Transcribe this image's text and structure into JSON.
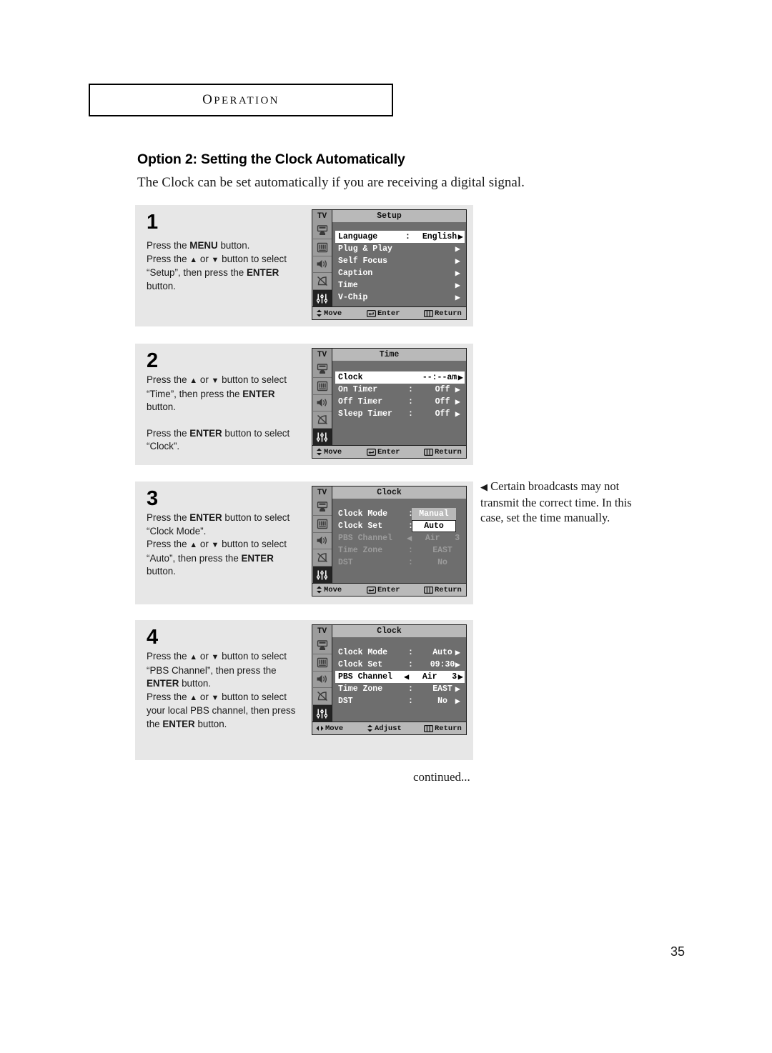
{
  "page": {
    "chapter": "Operation",
    "chapter_first_letter": "O",
    "chapter_rest": "PERATION",
    "section_title": "Option 2: Setting the Clock Automatically",
    "section_intro": "The Clock can be set automatically if you are receiving a digital signal.",
    "continued_label": "continued...",
    "page_number": "35"
  },
  "side_note": {
    "arrow": "◀",
    "text": "Certain broadcasts may not transmit the correct time. In this case, set the time manually."
  },
  "glyphs": {
    "up_arrow": "▲",
    "down_arrow": "▼",
    "right_arrow": "▶",
    "left_arrow": "◀"
  },
  "colors": {
    "panel_bg": "#e7e7e7",
    "osd_body": "#6e6e6e",
    "osd_bar": "#b9b9b9",
    "osd_side": "#9c9c9c",
    "osd_active_icon": "#232323",
    "highlight_bg": "#ffffff",
    "dim_text": "#9b9b9b"
  },
  "steps": [
    {
      "number": "1",
      "lines": [
        {
          "parts": [
            {
              "t": "Press the ",
              "b": false
            },
            {
              "t": "MENU",
              "b": true
            },
            {
              "t": " button.",
              "b": false
            }
          ]
        },
        {
          "parts": [
            {
              "t": "Press the ",
              "b": false
            },
            {
              "t": "▲",
              "b": false
            },
            {
              "t": " or ",
              "b": false
            },
            {
              "t": "▼",
              "b": false
            },
            {
              "t": " button to select",
              "b": false
            }
          ]
        },
        {
          "parts": [
            {
              "t": "“Setup”, then press the ",
              "b": false
            },
            {
              "t": "ENTER",
              "b": true
            }
          ]
        },
        {
          "parts": [
            {
              "t": "button.",
              "b": false
            }
          ]
        }
      ],
      "osd": {
        "tv_label": "TV",
        "title": "Setup",
        "active_icon_index": 4,
        "rows": [
          {
            "label": "Language",
            "colon": ":",
            "value": "English",
            "arrow": "right",
            "state": "highlight"
          },
          {
            "label": "Plug & Play",
            "colon": "",
            "value": "",
            "arrow": "right",
            "state": "normal"
          },
          {
            "label": "Self Focus",
            "colon": "",
            "value": "",
            "arrow": "right",
            "state": "normal"
          },
          {
            "label": "Caption",
            "colon": "",
            "value": "",
            "arrow": "right",
            "state": "normal"
          },
          {
            "label": "Time",
            "colon": "",
            "value": "",
            "arrow": "right",
            "state": "normal"
          },
          {
            "label": "V-Chip",
            "colon": "",
            "value": "",
            "arrow": "right",
            "state": "normal"
          }
        ],
        "footer": {
          "move": "Move",
          "move_glyph": "updown",
          "mid": "Enter",
          "mid_glyph": "enter",
          "return": "Return",
          "return_glyph": "menu"
        }
      }
    },
    {
      "number": "2",
      "lines": [
        {
          "parts": [
            {
              "t": "Press the ",
              "b": false
            },
            {
              "t": "▲",
              "b": false
            },
            {
              "t": " or ",
              "b": false
            },
            {
              "t": "▼",
              "b": false
            },
            {
              "t": " button to select",
              "b": false
            }
          ]
        },
        {
          "parts": [
            {
              "t": "“Time”, then press the ",
              "b": false
            },
            {
              "t": "ENTER",
              "b": true
            }
          ]
        },
        {
          "parts": [
            {
              "t": "button.",
              "b": false
            }
          ]
        },
        {
          "gap": true
        },
        {
          "parts": [
            {
              "t": "Press the ",
              "b": false
            },
            {
              "t": "ENTER",
              "b": true
            },
            {
              "t": " button to select",
              "b": false
            }
          ]
        },
        {
          "parts": [
            {
              "t": "“Clock”.",
              "b": false
            }
          ]
        }
      ],
      "osd": {
        "tv_label": "TV",
        "title": "Time",
        "active_icon_index": 4,
        "rows": [
          {
            "label": "Clock",
            "colon": "",
            "value": "--:--am",
            "arrow": "right",
            "state": "highlight"
          },
          {
            "label": "On Timer",
            "colon": ":",
            "value": "Off",
            "arrow": "right",
            "state": "normal"
          },
          {
            "label": "Off Timer",
            "colon": ":",
            "value": "Off",
            "arrow": "right",
            "state": "normal"
          },
          {
            "label": "Sleep Timer",
            "colon": ":",
            "value": "Off",
            "arrow": "right",
            "state": "normal"
          }
        ],
        "footer": {
          "move": "Move",
          "move_glyph": "updown",
          "mid": "Enter",
          "mid_glyph": "enter",
          "return": "Return",
          "return_glyph": "menu"
        }
      }
    },
    {
      "number": "3",
      "lines": [
        {
          "parts": [
            {
              "t": "Press the ",
              "b": false
            },
            {
              "t": "ENTER",
              "b": true
            },
            {
              "t": " button to select",
              "b": false
            }
          ]
        },
        {
          "parts": [
            {
              "t": "“Clock Mode”.",
              "b": false
            }
          ]
        },
        {
          "parts": [
            {
              "t": "Press the ",
              "b": false
            },
            {
              "t": "▲",
              "b": false
            },
            {
              "t": " or ",
              "b": false
            },
            {
              "t": "▼",
              "b": false
            },
            {
              "t": " button to select",
              "b": false
            }
          ]
        },
        {
          "parts": [
            {
              "t": "“Auto”, then press the ",
              "b": false
            },
            {
              "t": "ENTER",
              "b": true
            }
          ]
        },
        {
          "parts": [
            {
              "t": "button.",
              "b": false
            }
          ]
        }
      ],
      "osd": {
        "tv_label": "TV",
        "title": "Clock",
        "active_icon_index": 4,
        "rows": [
          {
            "label": "Clock Mode",
            "colon": ":",
            "value": "",
            "arrow": "none",
            "state": "normal"
          },
          {
            "label": "Clock Set",
            "colon": ":",
            "value": "",
            "arrow": "none",
            "state": "normal"
          },
          {
            "label": "PBS Channel",
            "colon": "",
            "value": "Air   3",
            "arrow": "none",
            "left_arrow": true,
            "state": "dim"
          },
          {
            "label": "Time Zone",
            "colon": ":",
            "value": "EAST",
            "arrow": "none",
            "state": "dim"
          },
          {
            "label": "DST",
            "colon": ":",
            "value": "No",
            "arrow": "none",
            "state": "dim"
          }
        ],
        "dropdown": {
          "option_unselected": "Manual",
          "option_selected": "Auto"
        },
        "footer": {
          "move": "Move",
          "move_glyph": "updown",
          "mid": "Enter",
          "mid_glyph": "enter",
          "return": "Return",
          "return_glyph": "menu"
        }
      }
    },
    {
      "number": "4",
      "lines": [
        {
          "parts": [
            {
              "t": "Press the ",
              "b": false
            },
            {
              "t": "▲",
              "b": false
            },
            {
              "t": " or ",
              "b": false
            },
            {
              "t": "▼",
              "b": false
            },
            {
              "t": " button to select",
              "b": false
            }
          ]
        },
        {
          "parts": [
            {
              "t": "“PBS Channel”, then press the",
              "b": false
            }
          ]
        },
        {
          "parts": [
            {
              "t": "ENTER",
              "b": true
            },
            {
              "t": " button.",
              "b": false
            }
          ]
        },
        {
          "parts": [
            {
              "t": "Press the ",
              "b": false
            },
            {
              "t": "▲",
              "b": false
            },
            {
              "t": " or ",
              "b": false
            },
            {
              "t": "▼",
              "b": false
            },
            {
              "t": " button to select",
              "b": false
            }
          ]
        },
        {
          "parts": [
            {
              "t": "your local PBS channel, then press",
              "b": false
            }
          ]
        },
        {
          "parts": [
            {
              "t": "the ",
              "b": false
            },
            {
              "t": "ENTER",
              "b": true
            },
            {
              "t": " button.",
              "b": false
            }
          ]
        }
      ],
      "osd": {
        "tv_label": "TV",
        "title": "Clock",
        "active_icon_index": 4,
        "rows": [
          {
            "label": "Clock Mode",
            "colon": ":",
            "value": "Auto",
            "arrow": "right",
            "state": "normal"
          },
          {
            "label": "Clock Set",
            "colon": ":",
            "value": "09:30",
            "arrow": "right",
            "state": "normal"
          },
          {
            "label": "PBS Channel",
            "colon": "",
            "value": "Air   3",
            "arrow": "right",
            "left_arrow": true,
            "state": "highlight"
          },
          {
            "label": "Time Zone",
            "colon": ":",
            "value": "EAST",
            "arrow": "right",
            "state": "normal"
          },
          {
            "label": "DST",
            "colon": ":",
            "value": "No",
            "arrow": "right",
            "state": "normal"
          }
        ],
        "footer": {
          "move": "Move",
          "move_glyph": "leftright",
          "mid": "Adjust",
          "mid_glyph": "updown",
          "return": "Return",
          "return_glyph": "menu"
        }
      }
    }
  ]
}
